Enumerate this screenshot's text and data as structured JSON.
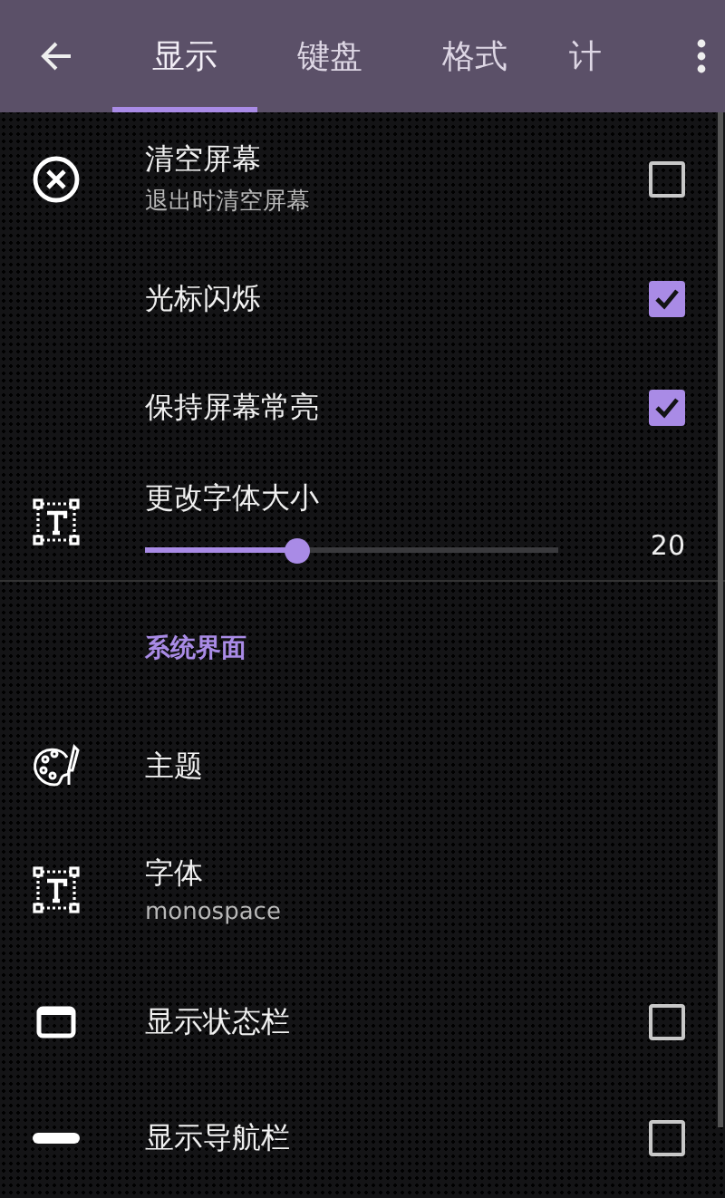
{
  "toolbar": {
    "tabs": [
      {
        "label": "显示",
        "selected": true
      },
      {
        "label": "键盘",
        "selected": false
      },
      {
        "label": "格式",
        "selected": false
      },
      {
        "label": "计",
        "selected": false
      }
    ]
  },
  "settings": [
    {
      "kind": "checkbox",
      "title": "清空屏幕",
      "subtitle": "退出时清空屏幕",
      "checked": false
    },
    {
      "kind": "checkbox",
      "title": "光标闪烁",
      "checked": true
    },
    {
      "kind": "checkbox",
      "title": "保持屏幕常亮",
      "checked": true
    },
    {
      "kind": "slider",
      "title": "更改字体大小",
      "level": 0.37,
      "reading": "20"
    },
    {
      "kind": "section",
      "title": "系统界面"
    },
    {
      "kind": "plain",
      "title": "主题"
    },
    {
      "kind": "plain",
      "title": "字体",
      "subtitle": "monospace"
    },
    {
      "kind": "checkbox",
      "title": "显示状态栏",
      "checked": false
    },
    {
      "kind": "checkbox",
      "title": "显示导航栏",
      "checked": false
    }
  ]
}
